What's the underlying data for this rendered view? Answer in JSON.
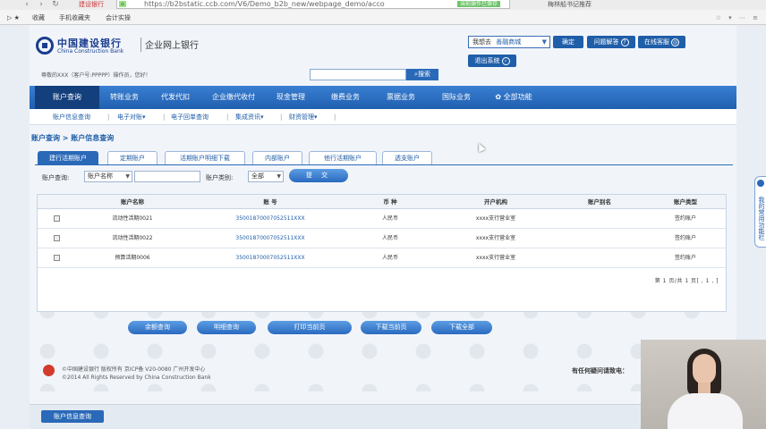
{
  "browser": {
    "url": "https://b2bstatic.ccb.com/V6/Demo_b2b_new/webpage_demo/acco",
    "tab_left": "建设银行",
    "url_badge": "当前操作已保存",
    "right_tab": "梅林船书记推荐",
    "bookmarks_label": "收藏",
    "bookmark_1": "手机收藏夹",
    "bookmark_2": "会计实操",
    "nav_back": "‹",
    "nav_fwd": "›",
    "nav_reload": "↻",
    "tools": "☆ ▾ ⋯ ≡"
  },
  "header": {
    "bank_cn": "中国建设银行",
    "bank_en": "China Construction Bank",
    "system_name": "企业网上银行",
    "want_label": "我想去",
    "want_value": "善融商城",
    "confirm": "确定",
    "help": "问题解答",
    "service": "在线客服",
    "logout": "退出系统"
  },
  "user_info": "尊敬的XXX（客户号:PPPPP）操作员，您好！",
  "search": {
    "button": "搜索"
  },
  "main_nav": [
    {
      "label": "账户查询"
    },
    {
      "label": "转账业务"
    },
    {
      "label": "代发代扣"
    },
    {
      "label": "企业缴代收付"
    },
    {
      "label": "现金管理"
    },
    {
      "label": "缴费业务"
    },
    {
      "label": "票据业务"
    },
    {
      "label": "国际业务"
    },
    {
      "label": "全部功能"
    }
  ],
  "sub_nav": [
    {
      "label": "账户信息查询"
    },
    {
      "label": "电子对账▾"
    },
    {
      "label": "电子回单查询"
    },
    {
      "label": "集成资讯▾"
    },
    {
      "label": "财资管理▾"
    }
  ],
  "breadcrumb": "账户查询 > 账户信息查询",
  "tabs": [
    {
      "label": "建行活期账户"
    },
    {
      "label": "定期账户"
    },
    {
      "label": "活期账户明细下载"
    },
    {
      "label": "内部账户"
    },
    {
      "label": "他行活期账户"
    },
    {
      "label": "透支账户"
    }
  ],
  "filter": {
    "acct_query_label": "账户查询:",
    "acct_query_select": "账户名称",
    "acct_type_label": "账户类别:",
    "acct_type_select": "全部",
    "submit": "提 交"
  },
  "table": {
    "headers": [
      "账户名称",
      "账 号",
      "币 种",
      "开户机构",
      "账户别名",
      "账户类型"
    ],
    "rows": [
      {
        "name": "流动性活期0021",
        "account": "35001870007052511XXX",
        "currency": "人民币",
        "branch": "xxxx支行营业室",
        "alias": "",
        "type": "签约账户"
      },
      {
        "name": "流动性活期0022",
        "account": "35001870007052511XXX",
        "currency": "人民币",
        "branch": "xxxx支行营业室",
        "alias": "",
        "type": "签约账户"
      },
      {
        "name": "预算活期0006",
        "account": "35001870007052511XXX",
        "currency": "人民币",
        "branch": "xxxx支行营业室",
        "alias": "",
        "type": "签约账户"
      }
    ],
    "pager": "第 1 页/共 1 页[ , 1 , ]"
  },
  "actions": [
    {
      "label": "余额查询"
    },
    {
      "label": "明细查询"
    },
    {
      "label": "打印当前页"
    },
    {
      "label": "下载当前页"
    },
    {
      "label": "下载全部"
    }
  ],
  "footer": {
    "line1": "©中国建设银行 版权所有  京ICP备 V20-0080  广州开发中心",
    "line2": "©2014 All Rights Reserved by China Construction Bank",
    "right": "有任何疑问请致电："
  },
  "bottom_tab": "账户信息查询",
  "side_tab": "我的常用功能栏"
}
